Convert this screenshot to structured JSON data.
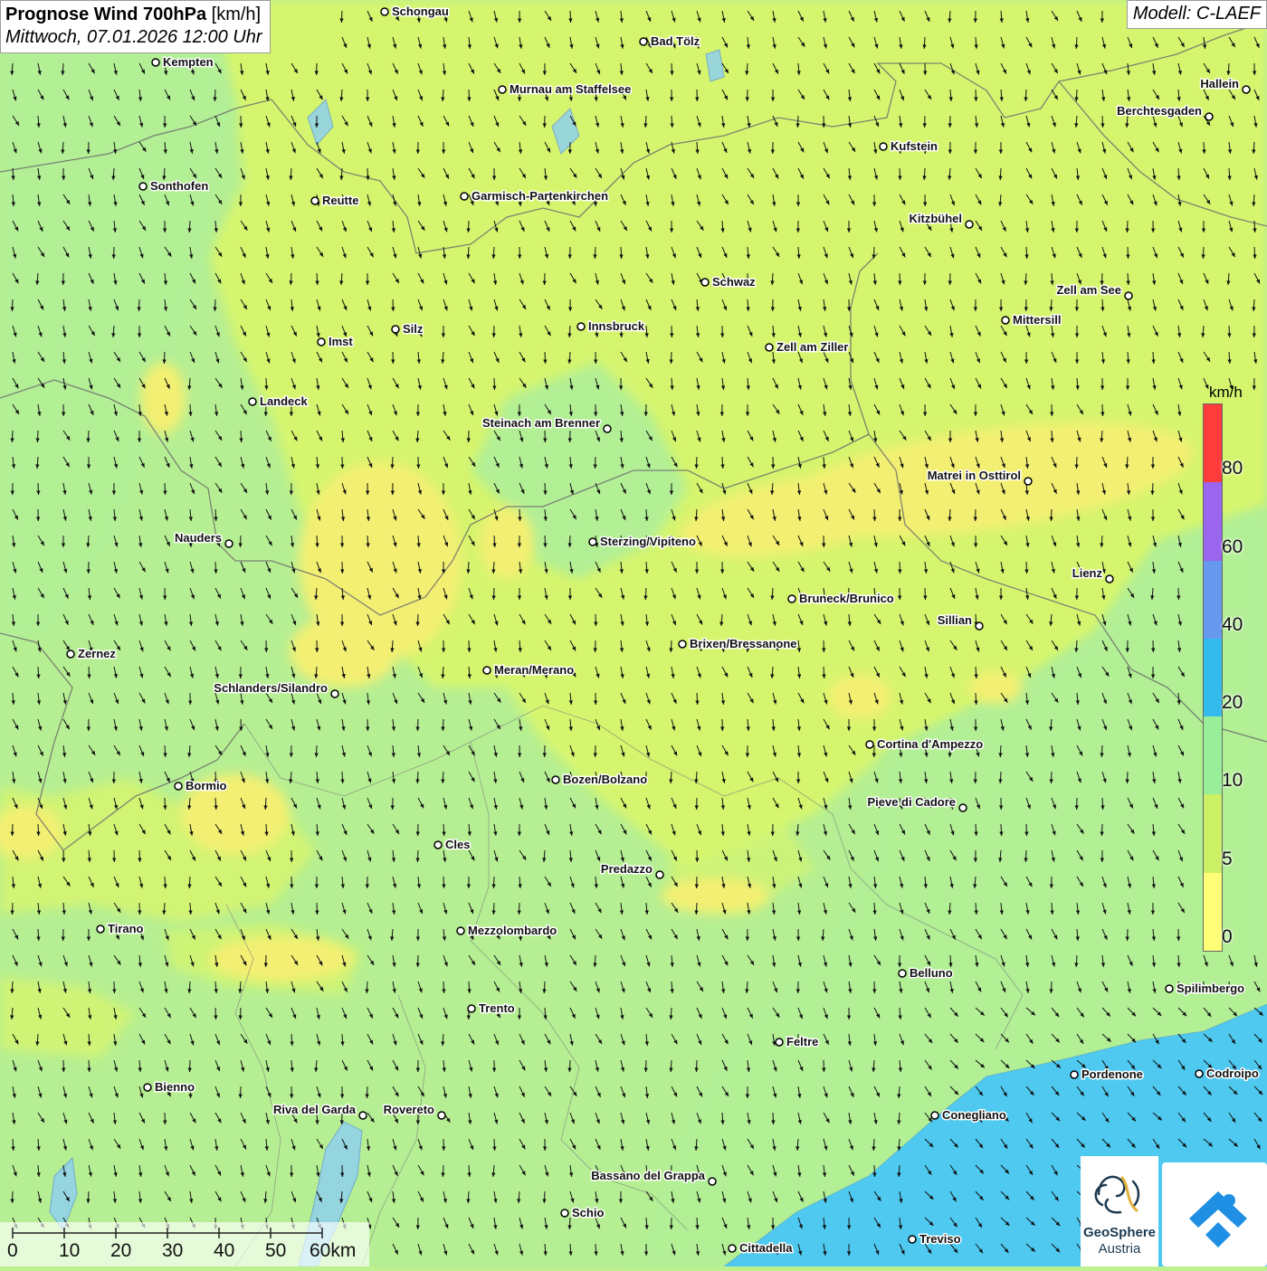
{
  "header": {
    "title_bold": "Prognose Wind 700hPa",
    "title_unit": "[km/h]",
    "datetime": "Mittwoch, 07.01.2026 12:00 Uhr",
    "model": "Modell: C-LAEF"
  },
  "legend": {
    "unit": "km/h",
    "labels": [
      "80",
      "60",
      "40",
      "20",
      "10",
      "5",
      "0"
    ],
    "colors": [
      "#ff3b3b",
      "#9b66ee",
      "#6699ee",
      "#33bbee",
      "#99ee99",
      "#ccf066",
      "#ffff77"
    ]
  },
  "scale_bar": {
    "labels": [
      "0",
      "10",
      "20",
      "30",
      "40",
      "50",
      "60km"
    ]
  },
  "logos": {
    "geosphere_line1": "GeoSphere",
    "geosphere_line2": "Austria"
  },
  "colors": {
    "calm_yellow": "#f5ef6e",
    "light_green": "#d4f570",
    "green": "#a6ee9a",
    "blue": "#4cc7ef"
  },
  "cities": [
    {
      "name": "Schongau",
      "label_side": "right"
    },
    {
      "name": "Bad Tölz",
      "label_side": "right"
    },
    {
      "name": "Kempten",
      "label_side": "right"
    },
    {
      "name": "Murnau am Staffelsee",
      "label_side": "right"
    },
    {
      "name": "Hallein",
      "label_side": "left"
    },
    {
      "name": "Berchtesgaden",
      "label_side": "left"
    },
    {
      "name": "Kufstein",
      "label_side": "right"
    },
    {
      "name": "Sonthofen",
      "label_side": "right"
    },
    {
      "name": "Reutte",
      "label_side": "right"
    },
    {
      "name": "Garmisch-Partenkirchen",
      "label_side": "right"
    },
    {
      "name": "Kitzbühel",
      "label_side": "left"
    },
    {
      "name": "Schwaz",
      "label_side": "right"
    },
    {
      "name": "Zell am See",
      "label_side": "left"
    },
    {
      "name": "Innsbruck",
      "label_side": "right"
    },
    {
      "name": "Silz",
      "label_side": "right"
    },
    {
      "name": "Mittersill",
      "label_side": "right"
    },
    {
      "name": "Imst",
      "label_side": "right"
    },
    {
      "name": "Zell am Ziller",
      "label_side": "right"
    },
    {
      "name": "Landeck",
      "label_side": "right"
    },
    {
      "name": "Steinach am Brenner",
      "label_side": "left"
    },
    {
      "name": "Matrei in Osttirol",
      "label_side": "left"
    },
    {
      "name": "Nauders",
      "label_side": "left"
    },
    {
      "name": "Sterzing/Vipiteno",
      "label_side": "right"
    },
    {
      "name": "Lienz",
      "label_side": "left"
    },
    {
      "name": "Bruneck/Brunico",
      "label_side": "right"
    },
    {
      "name": "Sillian",
      "label_side": "left"
    },
    {
      "name": "Brixen/Bressanone",
      "label_side": "right"
    },
    {
      "name": "Zernez",
      "label_side": "right"
    },
    {
      "name": "Meran/Merano",
      "label_side": "right"
    },
    {
      "name": "Schlanders/Silandro",
      "label_side": "left"
    },
    {
      "name": "Cortina d'Ampezzo",
      "label_side": "right"
    },
    {
      "name": "Bozen/Bolzano",
      "label_side": "right"
    },
    {
      "name": "Bormio",
      "label_side": "right"
    },
    {
      "name": "Pieve di Cadore",
      "label_side": "left"
    },
    {
      "name": "Cles",
      "label_side": "right"
    },
    {
      "name": "Predazzo",
      "label_side": "left"
    },
    {
      "name": "Tirano",
      "label_side": "right"
    },
    {
      "name": "Mezzolombardo",
      "label_side": "right"
    },
    {
      "name": "Belluno",
      "label_side": "right"
    },
    {
      "name": "Spilimbergo",
      "label_side": "right"
    },
    {
      "name": "Trento",
      "label_side": "right"
    },
    {
      "name": "Feltre",
      "label_side": "right"
    },
    {
      "name": "Pordenone",
      "label_side": "right"
    },
    {
      "name": "Codroipo",
      "label_side": "right"
    },
    {
      "name": "Bienno",
      "label_side": "right"
    },
    {
      "name": "Riva del Garda",
      "label_side": "left"
    },
    {
      "name": "Rovereto",
      "label_side": "left"
    },
    {
      "name": "Conegliano",
      "label_side": "right"
    },
    {
      "name": "Bassano del Grappa",
      "label_side": "left"
    },
    {
      "name": "Schio",
      "label_side": "right"
    },
    {
      "name": "Treviso",
      "label_side": "right"
    },
    {
      "name": "Cittadella",
      "label_side": "right"
    }
  ]
}
